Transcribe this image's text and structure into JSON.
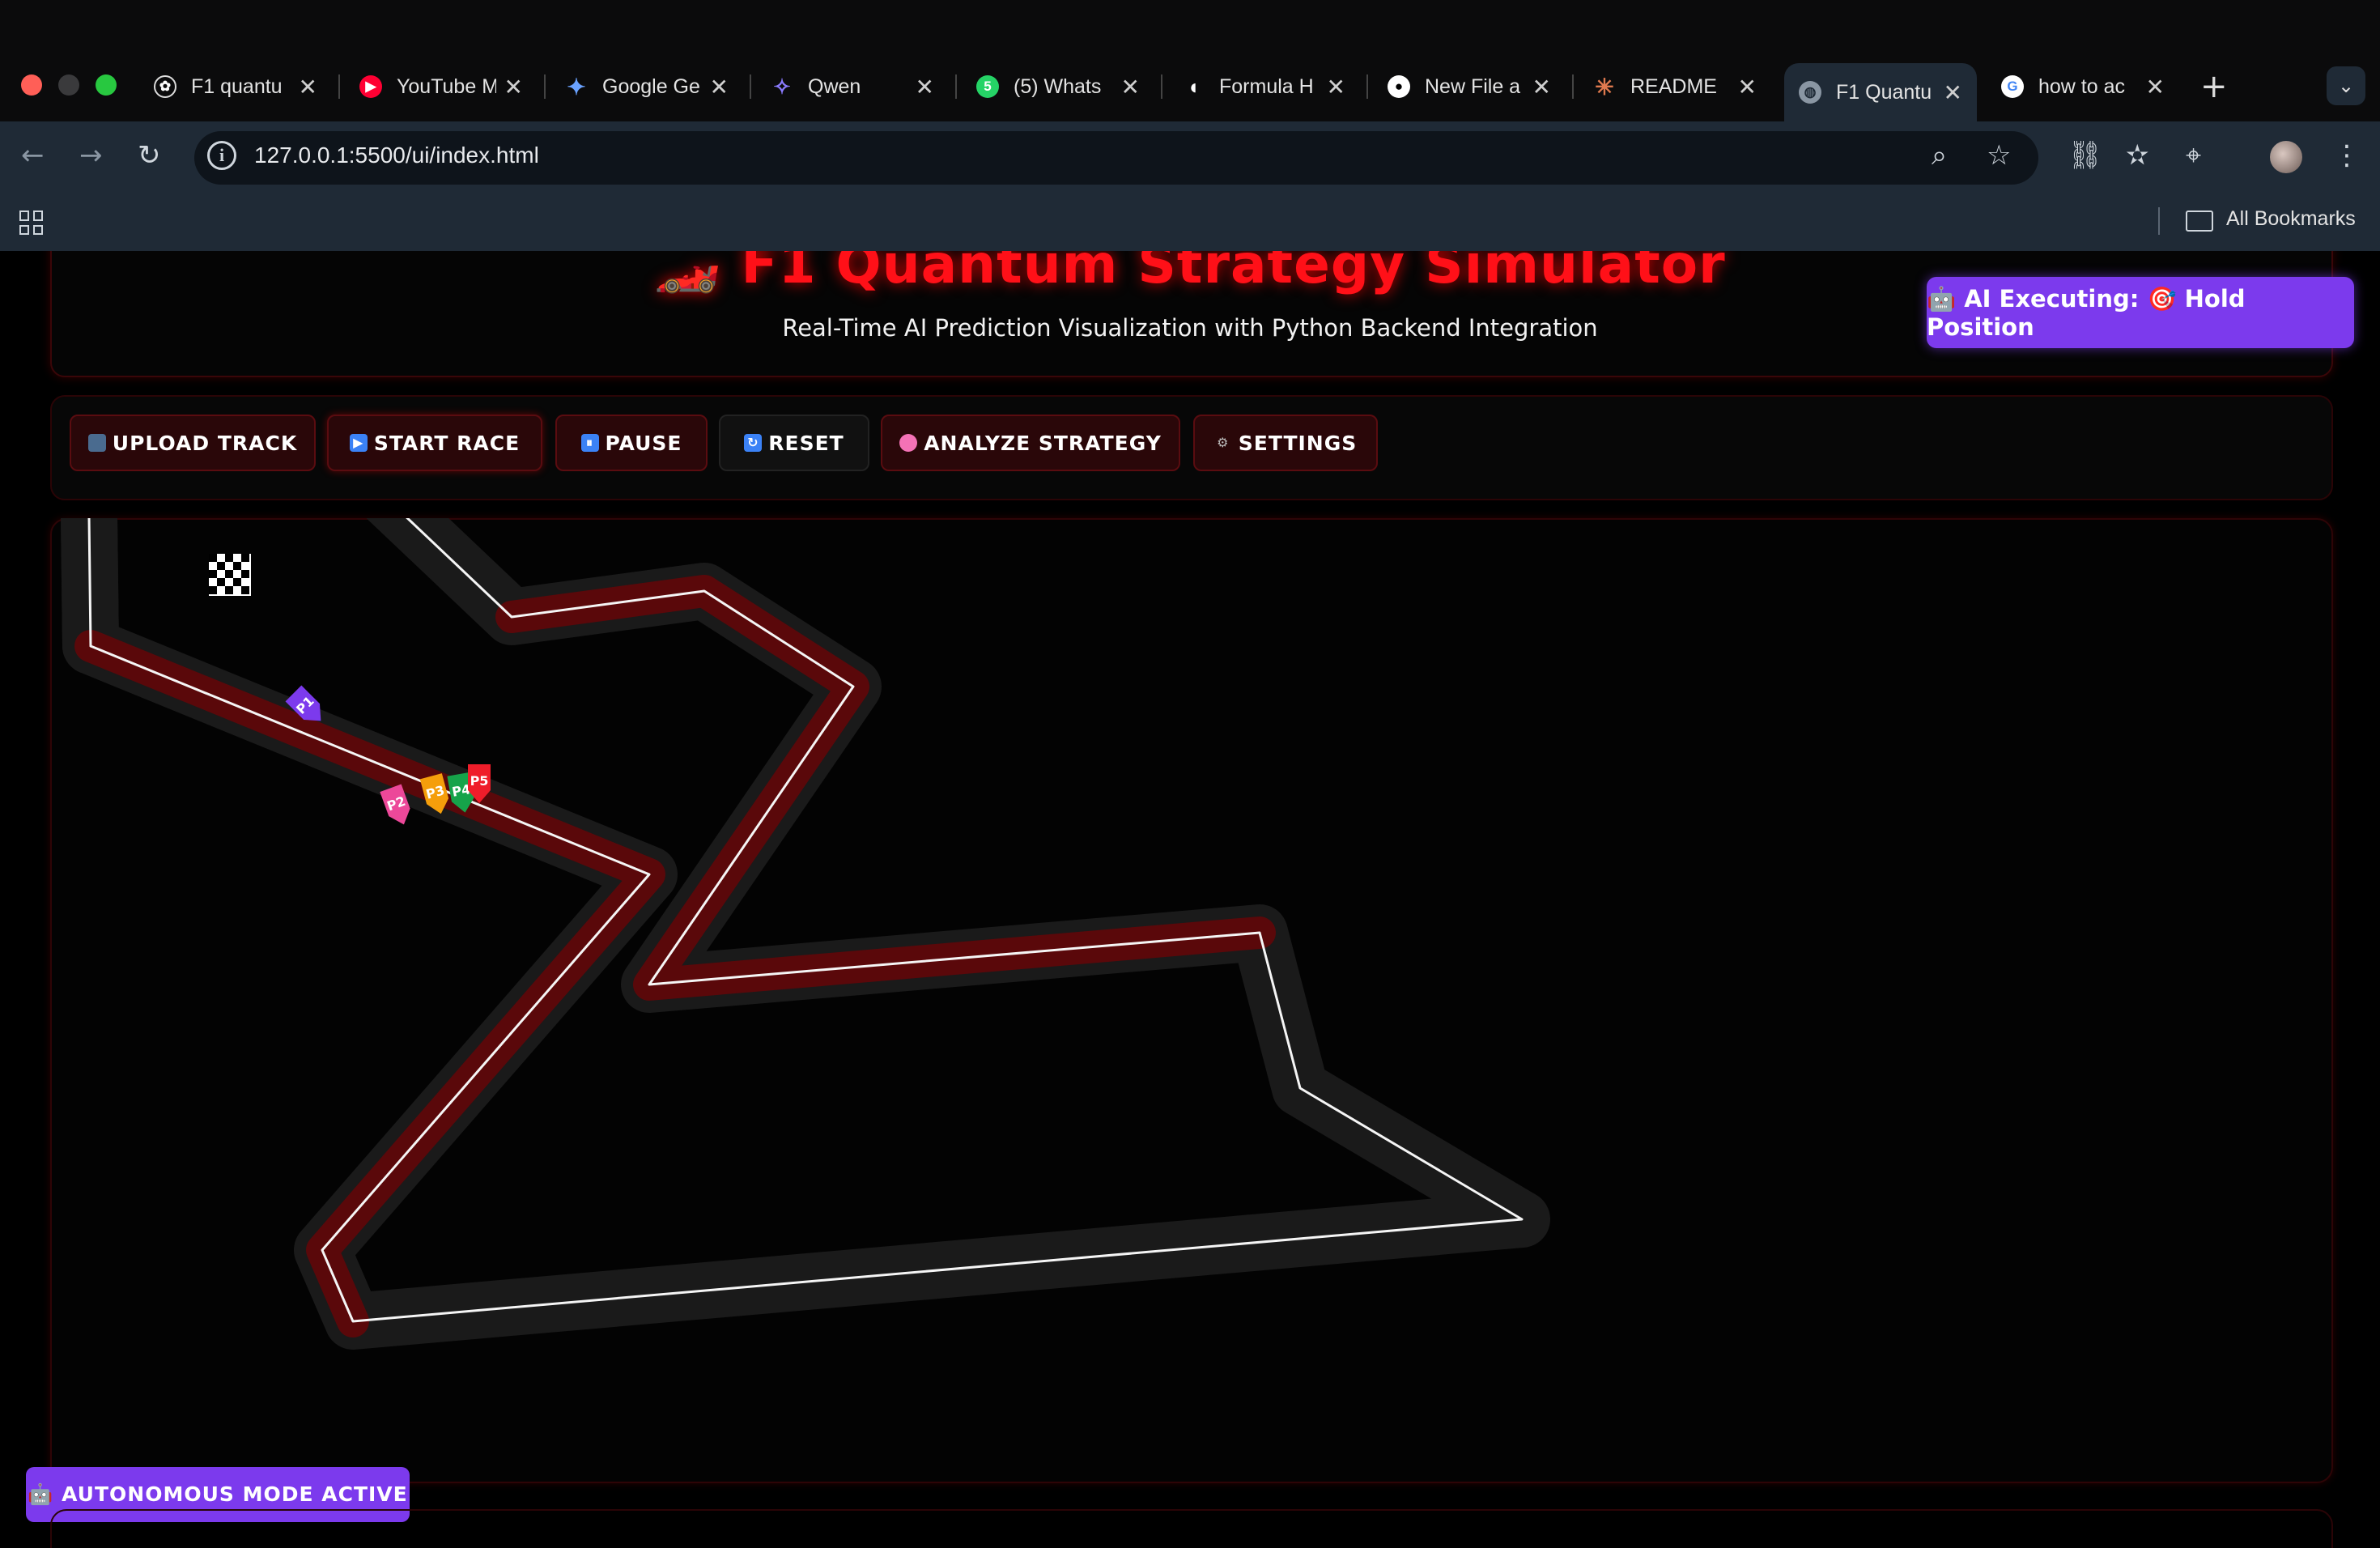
{
  "browser": {
    "tabs": [
      {
        "title": "F1 quantu",
        "icon": "openai-icon",
        "active": false
      },
      {
        "title": "YouTube M",
        "icon": "youtube-icon",
        "active": false
      },
      {
        "title": "Google Ge",
        "icon": "gemini-icon",
        "active": false
      },
      {
        "title": "Qwen",
        "icon": "qwen-icon",
        "active": false
      },
      {
        "title": "(5) Whats",
        "icon": "whatsapp-icon",
        "active": false
      },
      {
        "title": "Formula H",
        "icon": "formula-icon",
        "active": false
      },
      {
        "title": "New File a",
        "icon": "github-icon",
        "active": false
      },
      {
        "title": "README",
        "icon": "claude-icon",
        "active": false
      },
      {
        "title": "F1 Quantu",
        "icon": "globe-icon",
        "active": true
      },
      {
        "title": "how to ac",
        "icon": "google-icon",
        "active": false
      }
    ],
    "url": "127.0.0.1:5500/ui/index.html",
    "all_bookmarks": "All Bookmarks"
  },
  "app": {
    "title": "🏎️ F1 Quantum Strategy Simulator",
    "subtitle": "Real-Time AI Prediction Visualization with Python Backend Integration",
    "ai_status": "🤖 AI Executing: 🎯 Hold Position",
    "autonomous": "🤖 AUTONOMOUS MODE ACTIVE"
  },
  "controls": {
    "upload": "UPLOAD TRACK",
    "start": "START RACE",
    "pause": "PAUSE",
    "reset": "RESET",
    "analyze": "ANALYZE STRATEGY",
    "settings": "SETTINGS"
  },
  "track": {
    "cars": [
      {
        "label": "P1",
        "color": "#7c3aed"
      },
      {
        "label": "P2",
        "color": "#ec4899"
      },
      {
        "label": "P3",
        "color": "#f59e0b"
      },
      {
        "label": "P4",
        "color": "#16a34a"
      },
      {
        "label": "P5",
        "color": "#ef1d2a"
      }
    ]
  },
  "colors": {
    "accent_red": "#ff1018",
    "accent_purple": "#7c3aed",
    "chrome": "#1f2a36"
  }
}
